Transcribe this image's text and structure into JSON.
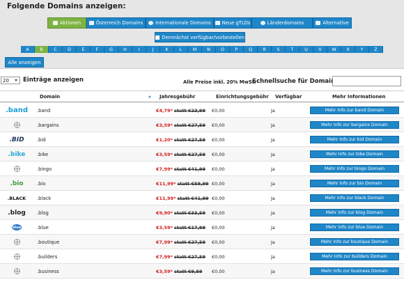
{
  "panel": {
    "title": "Folgende Domains anzeigen:"
  },
  "categories": [
    {
      "label": "Aktionen",
      "icon": "cart-icon",
      "active": true
    },
    {
      "label": "Österreich Domains",
      "icon": "flag-icon",
      "active": false
    },
    {
      "label": "Internationale Domains",
      "icon": "globe-icon",
      "active": false
    },
    {
      "label": "Neue gTLDs",
      "icon": "thumbs-up-icon",
      "active": false
    },
    {
      "label": "Länderdomains",
      "icon": "globe-icon",
      "active": false
    },
    {
      "label": "Alternative",
      "icon": "plus-icon",
      "active": false
    }
  ],
  "later_button": {
    "label": "Demnächst verfügbar/vorbestellen",
    "icon": "calendar-icon"
  },
  "letters": [
    "A",
    "B",
    "C",
    "D",
    "E",
    "F",
    "G",
    "H",
    "I",
    "J",
    "K",
    "L",
    "M",
    "N",
    "O",
    "P",
    "Q",
    "R",
    "S",
    "T",
    "U",
    "V",
    "W",
    "X",
    "Y",
    "Z"
  ],
  "active_letter": "B",
  "show_all": "Alle anzeigen",
  "controls": {
    "entries_value": "20",
    "entries_label": "Einträge anzeigen",
    "price_note": "Alle Preise inkl. 20% MwSt. -",
    "quick_search_label": "Schnellsuche für Domains:",
    "quick_search_value": ""
  },
  "table": {
    "headers": {
      "domain": "Domain",
      "yearly": "Jahresgebühr",
      "setup": "Einrichtungsgebühr",
      "available": "Verfügbar",
      "more": "Mehr Informationen"
    },
    "rows": [
      {
        "logo": ".band",
        "domain": ".band",
        "price": "€4,79*",
        "old": "statt €23,99",
        "setup": "€0,00",
        "available": "Ja",
        "button": "Mehr Info zur band Domain"
      },
      {
        "logo": "",
        "domain": ".bargains",
        "price": "€3,59*",
        "old": "statt €27,59",
        "setup": "€0,00",
        "available": "Ja",
        "button": "Mehr Info zur bargains Domain"
      },
      {
        "logo": ".BID",
        "domain": ".bid",
        "price": "€1,20*",
        "old": "statt €27,59",
        "setup": "€0,00",
        "available": "Ja",
        "button": "Mehr Info zur bid Domain"
      },
      {
        "logo": ".bike",
        "domain": ".bike",
        "price": "€3,59*",
        "old": "statt €27,59",
        "setup": "€0,00",
        "available": "Ja",
        "button": "Mehr Info zur bike Domain"
      },
      {
        "logo": "",
        "domain": ".bingo",
        "price": "€7,99*",
        "old": "statt €41,99",
        "setup": "€0,00",
        "available": "Ja",
        "button": "Mehr Info zur bingo Domain"
      },
      {
        "logo": ".bio",
        "domain": ".bio",
        "price": "€11,99*",
        "old": "statt €59,99",
        "setup": "€0,00",
        "available": "Ja",
        "button": "Mehr Info zur bio Domain"
      },
      {
        "logo": ".BLACK",
        "domain": ".black",
        "price": "€11,99*",
        "old": "statt €41,99",
        "setup": "€0,00",
        "available": "Ja",
        "button": "Mehr Info zur black Domain"
      },
      {
        "logo": ".blog",
        "domain": ".blog",
        "price": "€9,90*",
        "old": "statt €33,59",
        "setup": "€0,00",
        "available": "Ja",
        "button": "Mehr Info zur blog Domain"
      },
      {
        "logo": "blue",
        "domain": ".blue",
        "price": "€3,59*",
        "old": "statt €17,99",
        "setup": "€0,00",
        "available": "Ja",
        "button": "Mehr Info zur blue Domain"
      },
      {
        "logo": "",
        "domain": ".boutique",
        "price": "€7,99*",
        "old": "statt €27,59",
        "setup": "€0,00",
        "available": "Ja",
        "button": "Mehr Info zur boutique Domain"
      },
      {
        "logo": "",
        "domain": ".builders",
        "price": "€7,99*",
        "old": "statt €27,59",
        "setup": "€0,00",
        "available": "Ja",
        "button": "Mehr Info zur builders Domain"
      },
      {
        "logo": "",
        "domain": ".business",
        "price": "€3,59*",
        "old": "statt €9,59",
        "setup": "€0,00",
        "available": "Ja",
        "button": "Mehr Info zur business Domain"
      }
    ]
  },
  "colors": {
    "accent": "#1f86c8",
    "active": "#7cb342",
    "price": "#d61a1a",
    "panel": "#e6e6e6"
  }
}
